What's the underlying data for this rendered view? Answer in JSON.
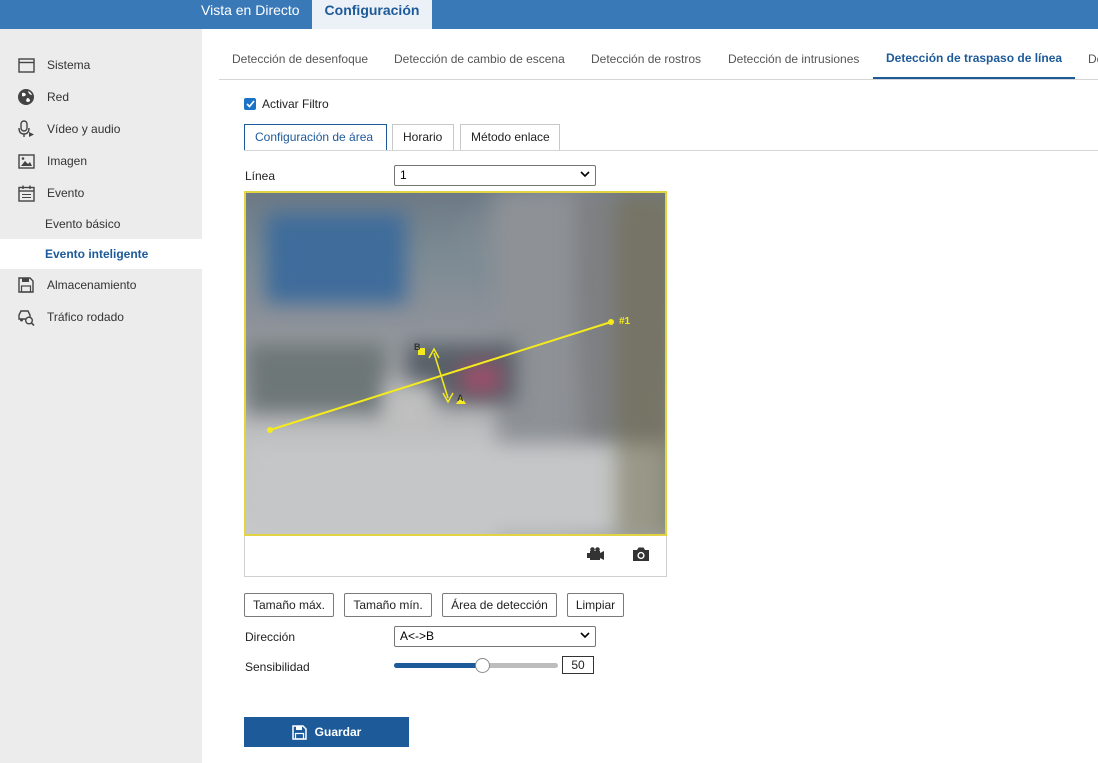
{
  "topbar": {
    "tabs": [
      {
        "label": "Vista en Directo"
      },
      {
        "label": "Configuración"
      }
    ]
  },
  "sidebar": {
    "items": [
      {
        "label": "Sistema",
        "icon": "monitor-icon"
      },
      {
        "label": "Red",
        "icon": "globe-icon"
      },
      {
        "label": "Vídeo y audio",
        "icon": "microphone-icon"
      },
      {
        "label": "Imagen",
        "icon": "image-icon"
      },
      {
        "label": "Evento",
        "icon": "calendar-icon"
      },
      {
        "label": "Evento básico"
      },
      {
        "label": "Evento inteligente"
      },
      {
        "label": "Almacenamiento",
        "icon": "save-icon"
      },
      {
        "label": "Tráfico rodado",
        "icon": "traffic-search-icon"
      }
    ]
  },
  "subtabs": [
    {
      "label": "Detección de desenfoque"
    },
    {
      "label": "Detección de cambio de escena"
    },
    {
      "label": "Detección de rostros"
    },
    {
      "label": "Detección de intrusiones"
    },
    {
      "label": "Detección de traspaso de línea"
    },
    {
      "label": "De"
    }
  ],
  "filter": {
    "label": "Activar Filtro",
    "checked": true
  },
  "steps": [
    {
      "label": "Configuración de área"
    },
    {
      "label": "Horario"
    },
    {
      "label": "Método enlace"
    }
  ],
  "line": {
    "label": "Línea",
    "value": "1"
  },
  "video": {
    "line_tag": "#1",
    "point_a": "A",
    "point_b": "B",
    "accent": "#f5ea1e"
  },
  "actions": {
    "max_size": "Tamaño máx.",
    "min_size": "Tamaño mín.",
    "detection_area": "Área de detección",
    "clear": "Limpiar"
  },
  "direction": {
    "label": "Dirección",
    "value": "A<->B"
  },
  "sensitivity": {
    "label": "Sensibilidad",
    "value": "50",
    "level": 0.5
  },
  "save": {
    "label": "Guardar"
  },
  "colors": {
    "topbar": "#3a79b8",
    "primary": "#1d5a99",
    "sidebar": "#ececec"
  }
}
